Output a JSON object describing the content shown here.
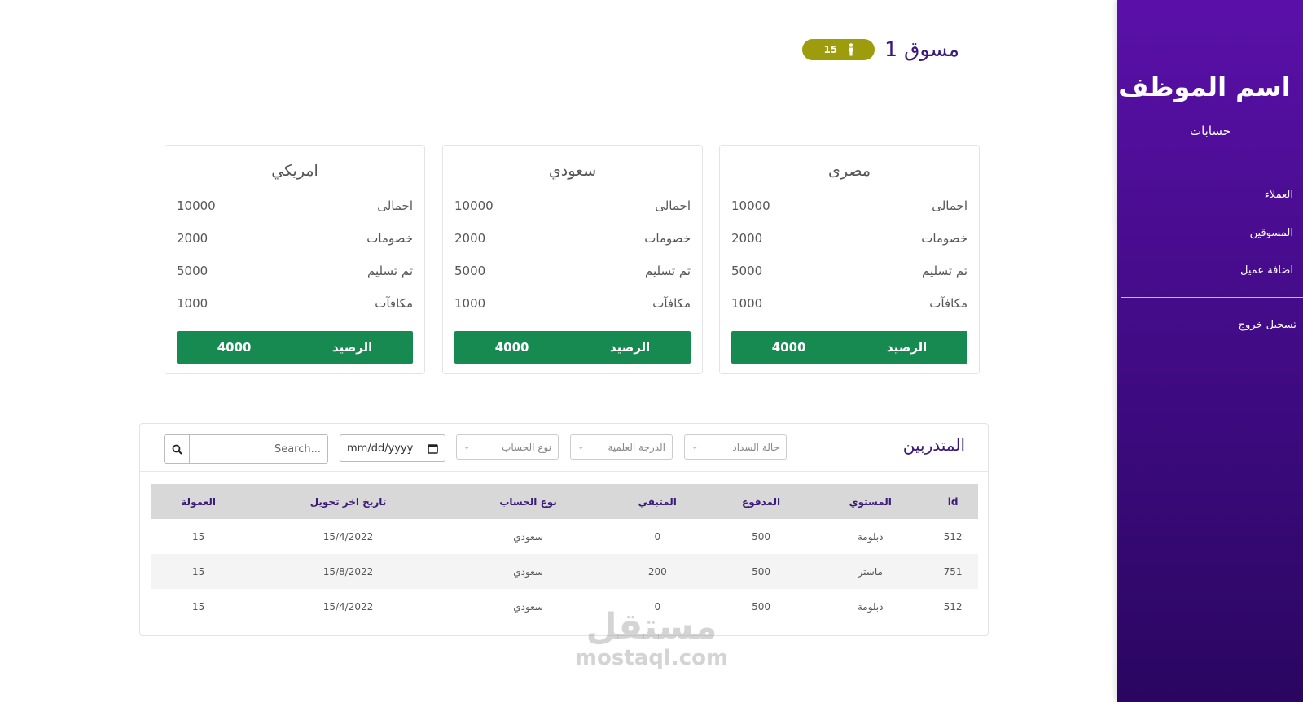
{
  "sidebar": {
    "employee_name": "اسم الموظف",
    "role": "حسابات",
    "nav": [
      "العملاء",
      "المسوقين",
      "اضافة عميل"
    ],
    "logout": "تسجيل خروج"
  },
  "header": {
    "marketer_title": "مسوق 1",
    "badge_count": "15",
    "badge_icon": "person-icon",
    "badge_color": "#9d9c0d"
  },
  "cards": [
    {
      "title": "مصرى",
      "rows": [
        [
          "اجمالى",
          "10000"
        ],
        [
          "خصومات",
          "2000"
        ],
        [
          "تم تسليم",
          "5000"
        ],
        [
          "مكافآت",
          "1000"
        ]
      ],
      "balance_label": "الرصيد",
      "balance_value": "4000"
    },
    {
      "title": "سعودي",
      "rows": [
        [
          "اجمالى",
          "10000"
        ],
        [
          "خصومات",
          "2000"
        ],
        [
          "تم تسليم",
          "5000"
        ],
        [
          "مكافآت",
          "1000"
        ]
      ],
      "balance_label": "الرصيد",
      "balance_value": "4000"
    },
    {
      "title": "امريكي",
      "rows": [
        [
          "اجمالى",
          "10000"
        ],
        [
          "خصومات",
          "2000"
        ],
        [
          "تم تسليم",
          "5000"
        ],
        [
          "مكافآت",
          "1000"
        ]
      ],
      "balance_label": "الرصيد",
      "balance_value": "4000"
    }
  ],
  "accent_green": "#178a52",
  "sidebar_purple": "#4a0c94",
  "trainees": {
    "title": "المتدربين",
    "filters": {
      "payment_status": "حالة السداد",
      "degree": "الدرجة العلمية",
      "account_type": "نوع الحساب",
      "date_placeholder": "mm/dd/yyyy",
      "search_placeholder": "Search..."
    },
    "columns": [
      "id",
      "المستوي",
      "المدفوع",
      "المتبقي",
      "نوع الحساب",
      "تاريخ اخر تحويل",
      "العمولة"
    ],
    "rows": [
      [
        "512",
        "دبلومة",
        "500",
        "0",
        "سعودي",
        "15/4/2022",
        "15"
      ],
      [
        "751",
        "ماستر",
        "500",
        "200",
        "سعودي",
        "15/8/2022",
        "15"
      ],
      [
        "512",
        "دبلومة",
        "500",
        "0",
        "سعودي",
        "15/4/2022",
        "15"
      ]
    ]
  },
  "watermark": {
    "arabic": "مستقل",
    "latin": "mostaql.com"
  }
}
